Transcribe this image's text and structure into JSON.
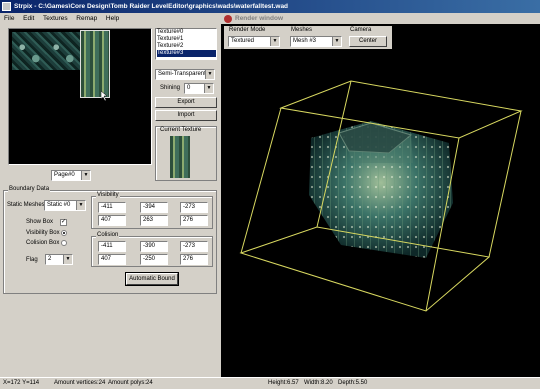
{
  "window": {
    "title": "Strpix - C:\\Games\\Core Design\\Tomb Raider LevelEditor\\graphics\\wads\\waterfalltest.wad"
  },
  "menu": [
    "File",
    "Edit",
    "Textures",
    "Remap",
    "Help"
  ],
  "texture_list": {
    "items": [
      "Texture#0",
      "Texture#1",
      "Texture#2",
      "Texture#3"
    ],
    "selected_index": 3
  },
  "blend_mode": "Semi-Transparent",
  "shining": {
    "label": "Shining",
    "value": "0"
  },
  "buttons": {
    "export": "Export",
    "import": "Import",
    "automatic_bound": "Automatic Bound"
  },
  "current_texture_label": "Current Texture",
  "page_select": "Page#0",
  "boundary": {
    "title": "Boundary Data",
    "static_meshes_label": "Static Meshes",
    "static_meshes_value": "Static #0",
    "show_box_label": "Show Box",
    "show_box_checked": "✓",
    "visibility_box_label": "Visibility Box",
    "collision_box_label": "Colision Box",
    "flag_label": "Flag",
    "flag_value": "2",
    "visibility": {
      "title": "Visibility",
      "row1": [
        "-411",
        "-394",
        "-273"
      ],
      "row2": [
        "407",
        "263",
        "276"
      ]
    },
    "collision": {
      "title": "Colision",
      "row1": [
        "-411",
        "-390",
        "-273"
      ],
      "row2": [
        "407",
        "-250",
        "276"
      ]
    }
  },
  "render_window": {
    "title": "Render window",
    "render_mode_label": "Render Mode",
    "render_mode_value": "Textured",
    "meshes_label": "Meshes",
    "meshes_value": "Mesh #3",
    "camera_label": "Camera",
    "center_button": "Center"
  },
  "status": {
    "coords": "X=172 Y=114",
    "vertices": "Amount vertices:24",
    "polys": "Amount polys:24",
    "height": "Height:6.57",
    "width": "Width:8.20",
    "depth": "Depth:5.50"
  },
  "colors": {
    "titlebar_start": "#0a246a",
    "titlebar_end": "#3a6ea5",
    "bbox_line": "#d8d860",
    "panel": "#d4d0c8"
  }
}
